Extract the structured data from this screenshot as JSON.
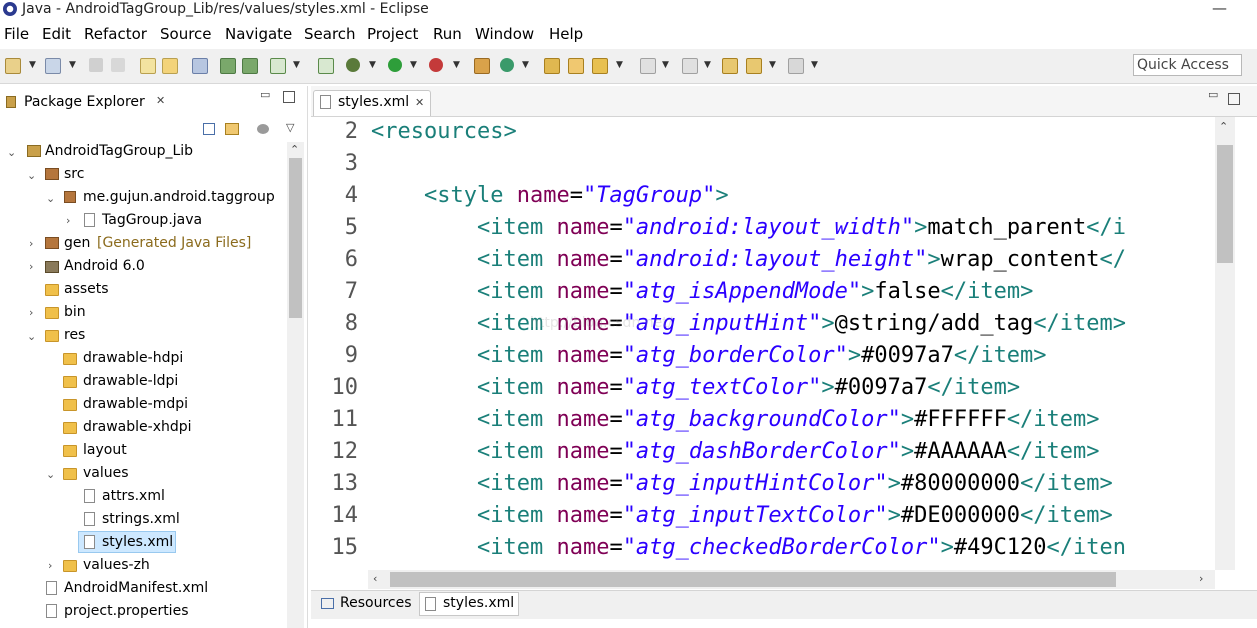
{
  "window": {
    "title": "Java - AndroidTagGroup_Lib/res/values/styles.xml - Eclipse",
    "minimize": "—"
  },
  "menu": [
    "File",
    "Edit",
    "Refactor",
    "Source",
    "Navigate",
    "Search",
    "Project",
    "Run",
    "Window",
    "Help"
  ],
  "toolbar": {
    "quick_access": "Quick Access"
  },
  "package_explorer": {
    "title": "Package Explorer",
    "tree": [
      {
        "label": "AndroidTagGroup_Lib",
        "extra": "",
        "icon": "project-icon"
      },
      {
        "label": "src",
        "extra": "",
        "icon": "source-folder-icon"
      },
      {
        "label": "me.gujun.android.taggroup",
        "extra": "",
        "icon": "package-icon"
      },
      {
        "label": "TagGroup.java",
        "extra": "",
        "icon": "java-file-icon"
      },
      {
        "label": "gen",
        "extra": "[Generated Java Files]",
        "icon": "source-folder-icon"
      },
      {
        "label": "Android 6.0",
        "extra": "",
        "icon": "library-icon"
      },
      {
        "label": "assets",
        "extra": "",
        "icon": "folder-icon"
      },
      {
        "label": "bin",
        "extra": "",
        "icon": "folder-icon"
      },
      {
        "label": "res",
        "extra": "",
        "icon": "folder-icon"
      },
      {
        "label": "drawable-hdpi",
        "extra": "",
        "icon": "folder-icon"
      },
      {
        "label": "drawable-ldpi",
        "extra": "",
        "icon": "folder-icon"
      },
      {
        "label": "drawable-mdpi",
        "extra": "",
        "icon": "folder-icon"
      },
      {
        "label": "drawable-xhdpi",
        "extra": "",
        "icon": "folder-icon"
      },
      {
        "label": "layout",
        "extra": "",
        "icon": "folder-icon"
      },
      {
        "label": "values",
        "extra": "",
        "icon": "folder-icon"
      },
      {
        "label": "attrs.xml",
        "extra": "",
        "icon": "xml-file-icon"
      },
      {
        "label": "strings.xml",
        "extra": "",
        "icon": "xml-file-icon"
      },
      {
        "label": "styles.xml",
        "extra": "",
        "icon": "xml-file-icon"
      },
      {
        "label": "values-zh",
        "extra": "",
        "icon": "folder-icon"
      },
      {
        "label": "AndroidManifest.xml",
        "extra": "",
        "icon": "xml-file-icon"
      },
      {
        "label": "project.properties",
        "extra": "",
        "icon": "properties-file-icon"
      }
    ]
  },
  "editor": {
    "tab": "styles.xml",
    "line_numbers": [
      "2",
      "3",
      "4",
      "5",
      "6",
      "7",
      "8",
      "9",
      "10",
      "11",
      "12",
      "13",
      "14",
      "15"
    ],
    "lines": [
      {
        "indent": "",
        "open": "<resources>",
        "attr": "",
        "eq": "",
        "val": "",
        "close": "",
        "text": "",
        "end": ""
      },
      {
        "indent": "",
        "open": "",
        "attr": "",
        "eq": "",
        "val": "",
        "close": "",
        "text": "",
        "end": ""
      },
      {
        "indent": "    ",
        "open": "<style ",
        "attr": "name",
        "eq": "=",
        "val": "\"TagGroup\"",
        "close": ">",
        "text": "",
        "end": ""
      },
      {
        "indent": "        ",
        "open": "<item ",
        "attr": "name",
        "eq": "=",
        "val": "\"android:layout_width\"",
        "close": ">",
        "text": "match_parent",
        "end": "</i"
      },
      {
        "indent": "        ",
        "open": "<item ",
        "attr": "name",
        "eq": "=",
        "val": "\"android:layout_height\"",
        "close": ">",
        "text": "wrap_content",
        "end": "</"
      },
      {
        "indent": "        ",
        "open": "<item ",
        "attr": "name",
        "eq": "=",
        "val": "\"atg_isAppendMode\"",
        "close": ">",
        "text": "false",
        "end": "</item>"
      },
      {
        "indent": "        ",
        "open": "<item ",
        "attr": "name",
        "eq": "=",
        "val": "\"atg_inputHint\"",
        "close": ">",
        "text": "@string/add_tag",
        "end": "</item>"
      },
      {
        "indent": "        ",
        "open": "<item ",
        "attr": "name",
        "eq": "=",
        "val": "\"atg_borderColor\"",
        "close": ">",
        "text": "#0097a7",
        "end": "</item>"
      },
      {
        "indent": "        ",
        "open": "<item ",
        "attr": "name",
        "eq": "=",
        "val": "\"atg_textColor\"",
        "close": ">",
        "text": "#0097a7",
        "end": "</item>"
      },
      {
        "indent": "        ",
        "open": "<item ",
        "attr": "name",
        "eq": "=",
        "val": "\"atg_backgroundColor\"",
        "close": ">",
        "text": "#FFFFFF",
        "end": "</item>"
      },
      {
        "indent": "        ",
        "open": "<item ",
        "attr": "name",
        "eq": "=",
        "val": "\"atg_dashBorderColor\"",
        "close": ">",
        "text": "#AAAAAA",
        "end": "</item>"
      },
      {
        "indent": "        ",
        "open": "<item ",
        "attr": "name",
        "eq": "=",
        "val": "\"atg_inputHintColor\"",
        "close": ">",
        "text": "#80000000",
        "end": "</item>"
      },
      {
        "indent": "        ",
        "open": "<item ",
        "attr": "name",
        "eq": "=",
        "val": "\"atg_inputTextColor\"",
        "close": ">",
        "text": "#DE000000",
        "end": "</item>"
      },
      {
        "indent": "        ",
        "open": "<item ",
        "attr": "name",
        "eq": "=",
        "val": "\"atg_checkedBorderColor\"",
        "close": ">",
        "text": "#49C120",
        "end": "</iten"
      }
    ]
  },
  "bottom_tabs": [
    "Resources",
    "styles.xml"
  ],
  "colors": {
    "tag": "#1a7f79",
    "attr": "#7f0055",
    "value": "#2a00ff",
    "selection": "#cde8ff"
  }
}
